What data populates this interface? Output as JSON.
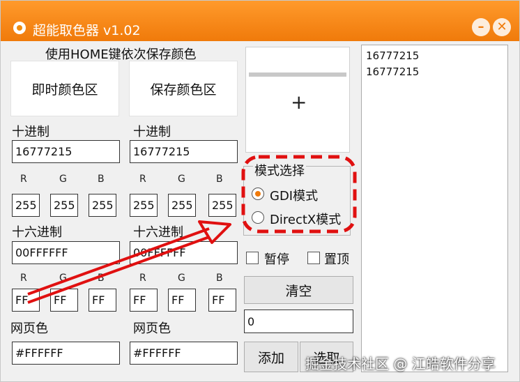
{
  "window": {
    "title": "超能取色器 v1.02",
    "minimize": "–",
    "close": "✕"
  },
  "hint": "使用HOME键依次保存颜色",
  "live_color_label": "即时颜色区",
  "saved_color_label": "保存颜色区",
  "decimal_label": "十进制",
  "hex_label": "十六进制",
  "web_color_label": "网页色",
  "rgb_labels": {
    "r": "R",
    "g": "G",
    "b": "B"
  },
  "live": {
    "decimal": "16777215",
    "r": "255",
    "g": "255",
    "b": "255",
    "hex": "00FFFFFF",
    "hex_r": "FF",
    "hex_g": "FF",
    "hex_b": "FF",
    "web": "#FFFFFF"
  },
  "saved": {
    "decimal": "16777215",
    "r": "255",
    "g": "255",
    "b": "255",
    "hex": "00FFFFFF",
    "hex_r": "FF",
    "hex_g": "FF",
    "hex_b": "FF",
    "web": "#FFFFFF"
  },
  "preview_crosshair": "+",
  "mode": {
    "title": "模式选择",
    "options": [
      "GDI模式",
      "DirectX模式"
    ],
    "selected": "GDI模式"
  },
  "pause_label": "暂停",
  "topmost_label": "置顶",
  "clear_button": "清空",
  "count_value": "0",
  "add_button": "添加",
  "pick_button": "选取",
  "history": [
    "16777215",
    "16777215"
  ],
  "watermark": "掘金技术社区 @ 江皓软件分享",
  "colors": {
    "title_bar": "#f58410",
    "annotation": "#e01010"
  }
}
